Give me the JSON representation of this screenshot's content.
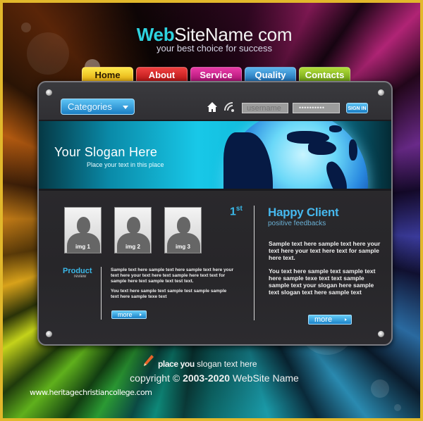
{
  "header": {
    "title_accent": "Web",
    "title_rest": "SiteName com",
    "tagline": "your best choice for success"
  },
  "nav": {
    "tabs": [
      {
        "label": "Home",
        "color": "#f5c518"
      },
      {
        "label": "About",
        "color": "#d42020"
      },
      {
        "label": "Service",
        "color": "#c81a88"
      },
      {
        "label": "Quality",
        "color": "#2a8ad0"
      },
      {
        "label": "Contacts",
        "color": "#8ab822"
      }
    ]
  },
  "toolbar": {
    "categories_label": "Categories",
    "home_icon": "home-icon",
    "rss_icon": "rss-icon",
    "username_placeholder": "username",
    "password_value": "••••••••••",
    "signin_label": "SIGN IN"
  },
  "banner": {
    "slogan": "Your Slogan Here",
    "subtext": "Place your text in this place"
  },
  "gallery": {
    "images": [
      {
        "label": "img 1"
      },
      {
        "label": "img 2"
      },
      {
        "label": "img 3"
      }
    ],
    "rank": "1",
    "rank_suffix": "st"
  },
  "product": {
    "title": "Product",
    "subtitle": "review",
    "paragraph1": "Sample text here sample text here sample text here your text here your text here text sample here text text for sample here text sample text test text.",
    "paragraph2": "You text here sample text sample test sample sample text here sample texe text",
    "more_label": "more"
  },
  "client": {
    "title": "Happy Client",
    "subtitle": "positive feedbacks",
    "paragraph1": "Sample text here sample text here your text here your text here text for sample here text.",
    "paragraph2": "You text here sample text sample text here sample texe text text sample sample text your slogan here sample text slogan text here sample text",
    "more_label": "more"
  },
  "footer": {
    "slogan_bold": "place you",
    "slogan_rest": " slogan text here",
    "copyright_prefix": "copyright © ",
    "copyright_years": "2003-2020",
    "copyright_suffix": " WebSite Name",
    "watermark": "www.heritagechristiancollege.com"
  },
  "colors": {
    "frame": "#e2b82b",
    "accent": "#2ed3e0",
    "button_blue": "#1a7ec4",
    "panel": "#2a292d"
  }
}
